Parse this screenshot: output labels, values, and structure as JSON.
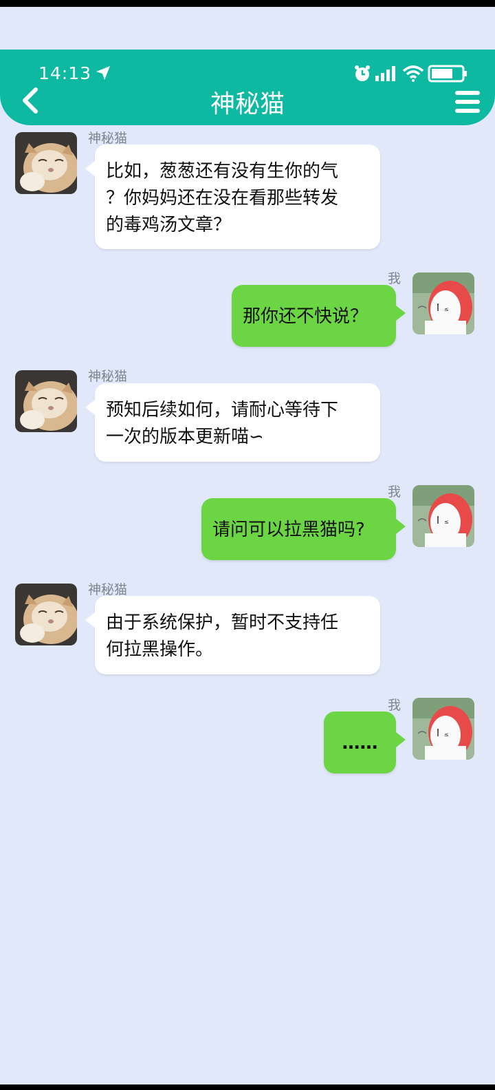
{
  "status_bar": {
    "time": "14:13"
  },
  "header": {
    "title": "神秘猫"
  },
  "messages": [
    {
      "sender": "神秘猫",
      "side": "left",
      "text": "比如，葱葱还有没有生你的气\n？你妈妈还在没在看那些转发\n的毒鸡汤文章？"
    },
    {
      "sender": "我",
      "side": "right",
      "text": "那你还不快说？"
    },
    {
      "sender": "神秘猫",
      "side": "left",
      "text": "预知后续如何，请耐心等待下\n一次的版本更新喵∽"
    },
    {
      "sender": "我",
      "side": "right",
      "text": "请问可以拉黑猫吗?"
    },
    {
      "sender": "神秘猫",
      "side": "left",
      "text": "由于系统保护，暂时不支持任\n何拉黑操作。"
    },
    {
      "sender": "我",
      "side": "right",
      "text": "……"
    }
  ],
  "colors": {
    "header": "#0db9a1",
    "background": "#e1e8f9",
    "my_bubble": "#6cd544",
    "their_bubble": "#ffffff"
  },
  "icons": [
    "location-arrow-icon",
    "alarm-icon",
    "signal-icon",
    "wifi-icon",
    "battery-icon",
    "back-chevron-icon",
    "menu-icon"
  ]
}
